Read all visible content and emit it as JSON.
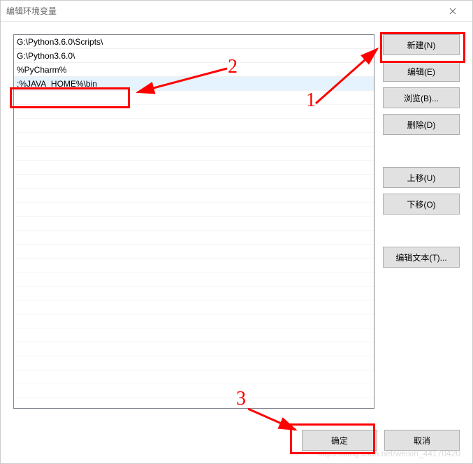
{
  "titlebar": {
    "title": "编辑环境变量"
  },
  "list": {
    "items": [
      "G:\\Python3.6.0\\Scripts\\",
      "G:\\Python3.6.0\\",
      "%PyCharm%",
      ";%JAVA_HOME%\\bin"
    ],
    "selectedIndex": 3
  },
  "buttons": {
    "new": "新建(N)",
    "edit": "编辑(E)",
    "browse": "浏览(B)...",
    "delete": "删除(D)",
    "moveUp": "上移(U)",
    "moveDown": "下移(O)",
    "editText": "编辑文本(T)..."
  },
  "footer": {
    "ok": "确定",
    "cancel": "取消"
  },
  "annotations": {
    "one": "1",
    "two": "2",
    "three": "3"
  },
  "watermark": "https://blog.csdn.net/weixin_44170420"
}
